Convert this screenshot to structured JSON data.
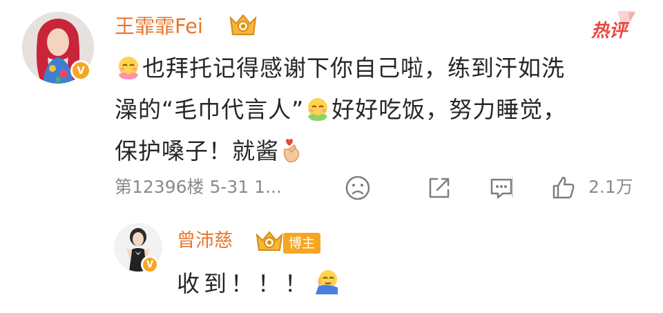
{
  "comment": {
    "username": "王霏霏Fei",
    "hot_label": "热评",
    "text_line1": "也拜托记得感谢下你自己啦，练到汗如洗",
    "text_line2a": "澡的“毛巾代言人”",
    "text_line2b": "好好吃饭，努力睡觉，",
    "text_line3": "保护嗓子！就酱",
    "meta": "第12396楼  5-31 1...",
    "likes": "2.1万",
    "verified_mark": "V"
  },
  "reply": {
    "username": "曾沛慈",
    "role_tag": "博主",
    "text": "收到！！！",
    "verified_mark": "V"
  },
  "icons": {
    "reaction": "dislike-face-icon",
    "share": "share-icon",
    "reply": "comment-icon",
    "like": "thumbs-up-icon"
  },
  "colors": {
    "username": "#e8762d",
    "badge": "#f5a623",
    "hot": "#e8473f",
    "meta": "#8a8a8a"
  }
}
